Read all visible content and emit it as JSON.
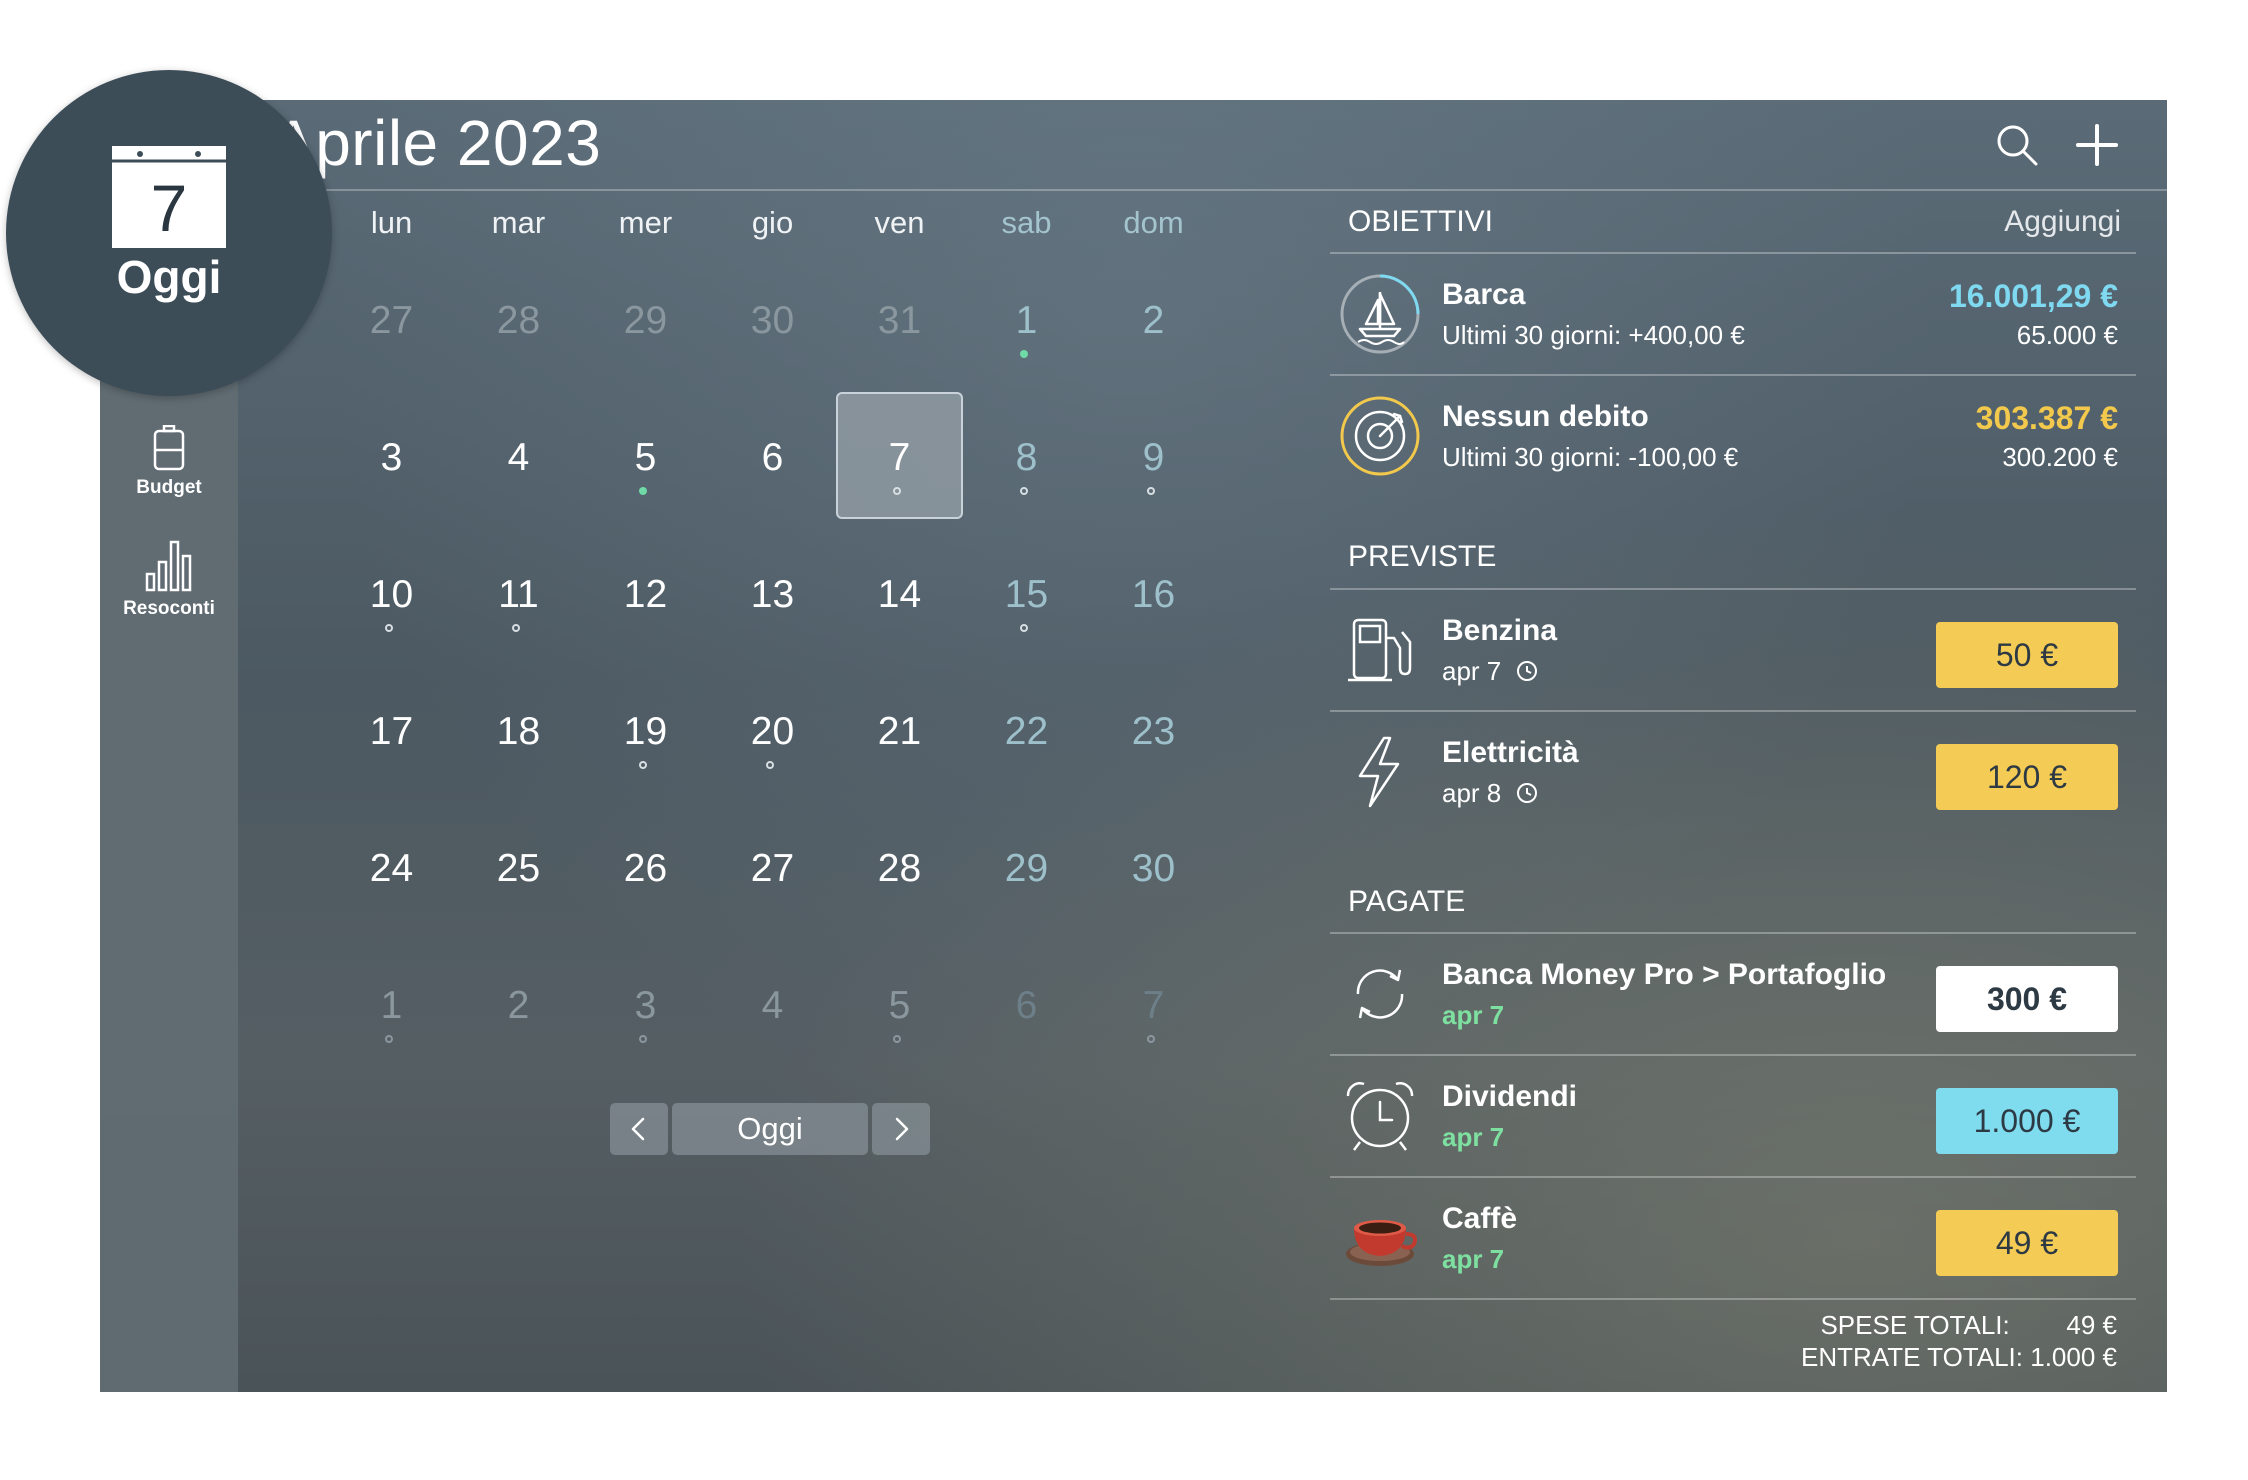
{
  "header": {
    "month_title": "Aprile 2023"
  },
  "today_badge": {
    "day": "7",
    "label": "Oggi"
  },
  "sidebar": {
    "items": [
      {
        "label": "Budget"
      },
      {
        "label": "Resoconti"
      }
    ]
  },
  "calendar": {
    "weekdays": [
      "lun",
      "mar",
      "mer",
      "gio",
      "ven",
      "sab",
      "dom"
    ],
    "weeks": [
      [
        "27",
        "28",
        "29",
        "30",
        "31",
        "1",
        "2"
      ],
      [
        "3",
        "4",
        "5",
        "6",
        "7",
        "8",
        "9"
      ],
      [
        "10",
        "11",
        "12",
        "13",
        "14",
        "15",
        "16"
      ],
      [
        "17",
        "18",
        "19",
        "20",
        "21",
        "22",
        "23"
      ],
      [
        "24",
        "25",
        "26",
        "27",
        "28",
        "29",
        "30"
      ],
      [
        "1",
        "2",
        "3",
        "4",
        "5",
        "6",
        "7"
      ]
    ],
    "nav": {
      "today_label": "Oggi"
    }
  },
  "goals": {
    "title": "OBIETTIVI",
    "action": "Aggiungi",
    "items": [
      {
        "name": "Barca",
        "sub": "Ultimi 30 giorni: +400,00 €",
        "amount": "16.001,29 €",
        "target": "65.000 €",
        "amount_color": "#7fd9f0",
        "icon": "sailboat-icon",
        "progress": 0.25
      },
      {
        "name": "Nessun debito",
        "sub": "Ultimi 30 giorni: -100,00 €",
        "amount": "303.387 €",
        "target": "300.200 €",
        "amount_color": "#f2c94c",
        "icon": "target-icon",
        "progress": 1.0
      }
    ]
  },
  "planned": {
    "title": "PREVISTE",
    "items": [
      {
        "name": "Benzina",
        "date": "apr 7",
        "amount": "50 €",
        "icon": "fuel-pump-icon",
        "pill_color": "#f4cc55"
      },
      {
        "name": "Elettricità",
        "date": "apr 8",
        "amount": "120 €",
        "icon": "lightning-icon",
        "pill_color": "#f4cc55"
      }
    ]
  },
  "paid": {
    "title": "PAGATE",
    "items": [
      {
        "name": "Banca Money Pro > Portafoglio",
        "date": "apr 7",
        "amount": "300 €",
        "icon": "transfer-icon",
        "pill_color": "#ffffff"
      },
      {
        "name": "Dividendi",
        "date": "apr 7",
        "amount": "1.000 €",
        "icon": "alarm-clock-icon",
        "pill_color": "#7fdbee"
      },
      {
        "name": "Caffè",
        "date": "apr 7",
        "amount": "49 €",
        "icon": "coffee-cup-icon",
        "pill_color": "#f4cc55"
      }
    ]
  },
  "totals": {
    "expenses_label": "SPESE TOTALI:",
    "expenses_value": "49 €",
    "income_label": "ENTRATE TOTALI:",
    "income_value": "1.000 €"
  }
}
